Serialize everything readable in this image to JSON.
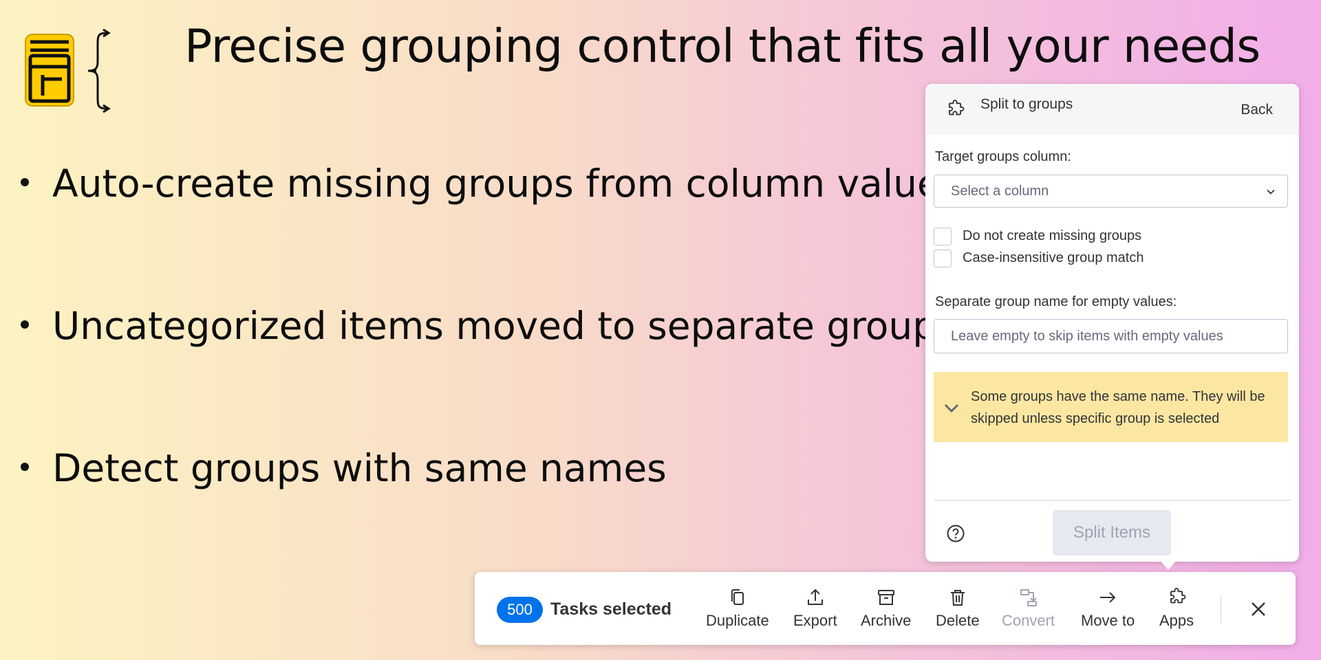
{
  "headline": "Precise grouping control that fits all your needs",
  "bullets": [
    "Auto-create missing groups from column values",
    "Uncategorized items moved to separate group",
    "Detect groups with same names"
  ],
  "panel": {
    "title": "Split to groups",
    "back_label": "Back",
    "target_column_label": "Target groups column:",
    "select_placeholder": "Select a column",
    "checkbox_no_create": "Do not create missing groups",
    "checkbox_case_insensitive": "Case-insensitive group match",
    "empty_values_label": "Separate group name for empty values:",
    "empty_values_placeholder": "Leave empty to skip items with empty values",
    "warning_text": "Some groups have the same name. They will be skipped unless specific group is selected",
    "split_button": "Split Items"
  },
  "actionbar": {
    "count": "500",
    "selected_label": "Tasks selected",
    "actions": {
      "duplicate": "Duplicate",
      "export": "Export",
      "archive": "Archive",
      "delete": "Delete",
      "convert": "Convert",
      "move_to": "Move to",
      "apps": "Apps"
    }
  },
  "colors": {
    "accent": "#0073ea",
    "warning_bg": "#fbe7a1",
    "logo_yellow": "#ffcc00"
  }
}
